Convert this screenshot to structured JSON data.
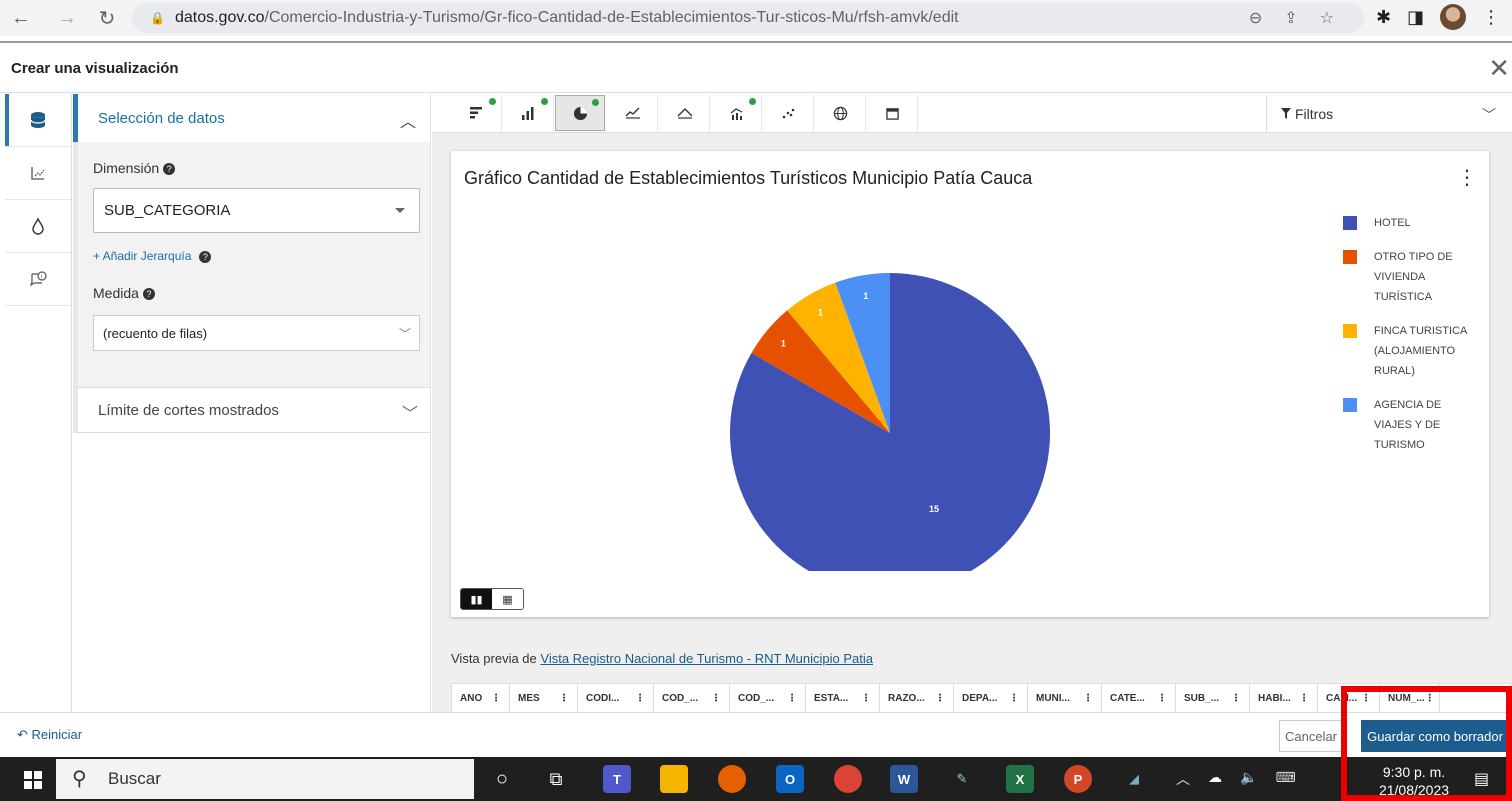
{
  "browser": {
    "url_domain": "datos.gov.co",
    "url_path": "/Comercio-Industria-y-Turismo/Gr-fico-Cantidad-de-Establecimientos-Tur-sticos-Mu/rfsh-amvk/edit"
  },
  "header": {
    "title": "Crear una visualización"
  },
  "panel": {
    "section_title": "Selección de datos",
    "dimension_label": "Dimensión",
    "dimension_value": "SUB_CATEGORIA",
    "add_hierarchy": "+ Añadir Jerarquía",
    "measure_label": "Medida",
    "measure_value": "(recuento de filas)",
    "limit_label": "Límite de cortes mostrados"
  },
  "toolbar": {
    "filters_label": "Filtros"
  },
  "chart_data": {
    "type": "pie",
    "title": "Gráfico Cantidad de Establecimientos Turísticos Municipio Patía Cauca",
    "slices": [
      {
        "label": "HOTEL",
        "value": 15,
        "color": "#3f51b5"
      },
      {
        "label": "OTRO TIPO DE VIVIENDA TURÍSTICA",
        "value": 1,
        "color": "#e65100"
      },
      {
        "label": "FINCA TURISTICA (ALOJAMIENTO RURAL)",
        "value": 1,
        "color": "#ffb300"
      },
      {
        "label": "AGENCIA DE VIAJES Y DE TURISMO",
        "value": 1,
        "color": "#4c8ff5"
      }
    ],
    "legend_position": "right"
  },
  "legend_lines": [
    [
      "HOTEL"
    ],
    [
      "OTRO TIPO DE",
      "VIVIENDA",
      "TURÍSTICA"
    ],
    [
      "FINCA TURISTICA",
      "(ALOJAMIENTO",
      "RURAL)"
    ],
    [
      "AGENCIA DE",
      "VIAJES Y DE",
      "TURISMO"
    ]
  ],
  "preview": {
    "prefix": "Vista previa de",
    "link": "Vista Registro Nacional de Turismo - RNT Municipio Patia"
  },
  "table": {
    "columns": [
      "ANO",
      "MES",
      "CODI...",
      "COD_...",
      "COD_...",
      "ESTA...",
      "RAZO...",
      "DEPA...",
      "MUNI...",
      "CATE...",
      "SUB_...",
      "HABI...",
      "CAM...",
      "NUM_..."
    ]
  },
  "footer": {
    "reset_label": "Reiniciar",
    "cancel_label": "Cancelar",
    "save_label": "Guardar como borrador"
  },
  "taskbar": {
    "search_placeholder": "Buscar",
    "time": "9:30 p. m.",
    "date": "21/08/2023"
  }
}
